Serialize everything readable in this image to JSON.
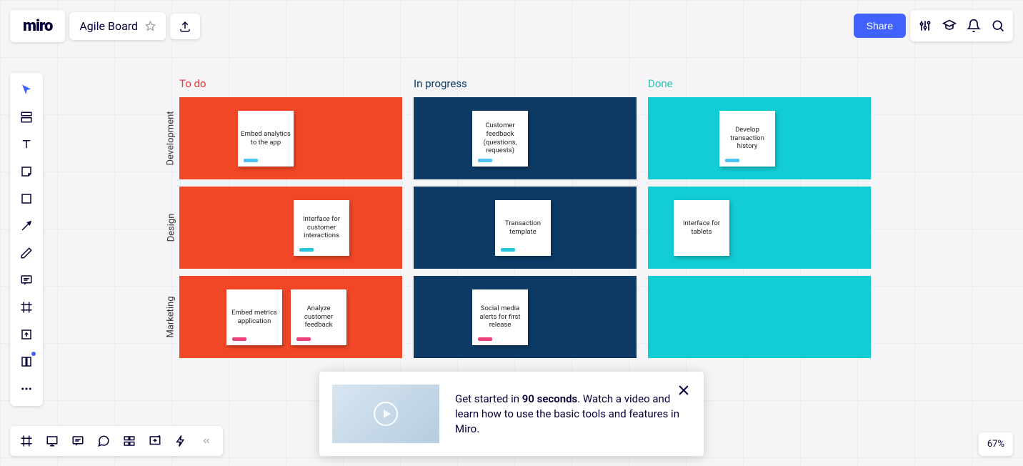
{
  "logo": "miro",
  "board_title": "Agile Board",
  "share_label": "Share",
  "zoom": "67%",
  "columns": {
    "todo": "To do",
    "inprog": "In progress",
    "done": "Done"
  },
  "rows": {
    "dev": "Development",
    "design": "Design",
    "marketing": "Marketing"
  },
  "cells": {
    "dev_todo": [
      {
        "text": "Embed analytics to the app",
        "tag": "blue"
      }
    ],
    "dev_inprog": [
      {
        "text": "Customer feedback (questions, requests)",
        "tag": "blue"
      }
    ],
    "dev_done": [
      {
        "text": "Develop transaction history",
        "tag": "blue"
      }
    ],
    "design_todo": [
      {
        "text": "Interface for customer interactions",
        "tag": "cyan"
      }
    ],
    "design_inprog": [
      {
        "text": "Transaction template",
        "tag": "cyan"
      }
    ],
    "design_done": [
      {
        "text": "Interface for tablets",
        "tag": ""
      }
    ],
    "marketing_todo": [
      {
        "text": "Embed metrics application",
        "tag": "pink"
      },
      {
        "text": "Analyze customer feedback",
        "tag": "pink"
      }
    ],
    "marketing_inprog": [
      {
        "text": "Social media alerts for first release",
        "tag": "pink"
      }
    ],
    "marketing_done": []
  },
  "popup": {
    "text_pre": "Get started in ",
    "text_bold": "90 seconds",
    "text_post": ". Watch a video and learn how to use the basic tools and features in Miro."
  }
}
